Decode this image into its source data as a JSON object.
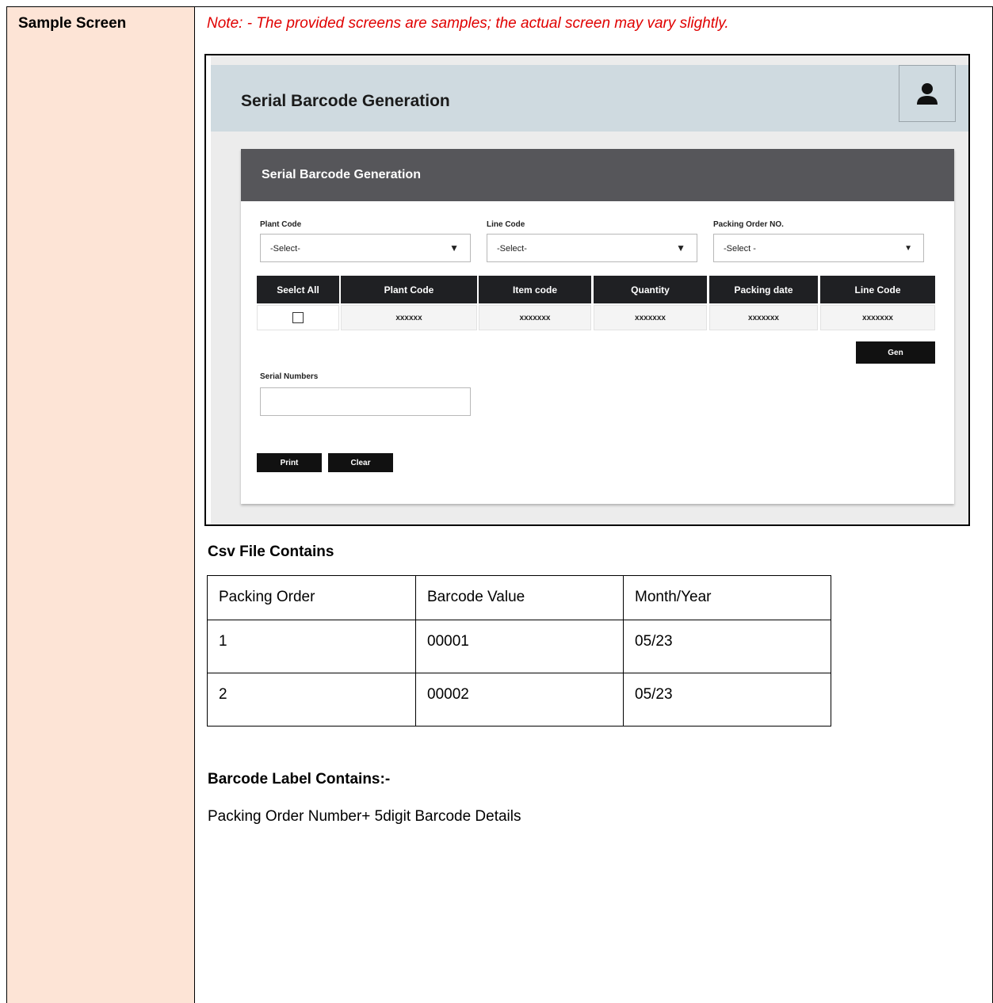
{
  "document": {
    "left_label": "Sample Screen",
    "note": "Note: - The provided screens are samples; the actual screen may vary slightly."
  },
  "mockup": {
    "header_title": "Serial Barcode Generation",
    "user_icon": "user-icon",
    "panel_title": "Serial Barcode Generation",
    "fields": [
      {
        "label": "Plant Code",
        "value": "-Select-"
      },
      {
        "label": "Line Code",
        "value": "-Select-"
      },
      {
        "label": "Packing Order NO.",
        "value": "-Select -"
      }
    ],
    "dropdown_arrow": "▼",
    "table": {
      "headers": [
        "Seelct All",
        "Plant Code",
        "Item code",
        "Quantity",
        "Packing date",
        "Line  Code"
      ],
      "row": [
        "",
        "xxxxxx",
        "xxxxxxx",
        "xxxxxxx",
        "xxxxxxx",
        "xxxxxxx"
      ]
    },
    "gen_label": "Gen",
    "serial_label": "Serial Numbers",
    "print_label": "Print",
    "clear_label": "Clear"
  },
  "csv": {
    "heading": "Csv File Contains",
    "headers": [
      "Packing Order",
      "Barcode Value",
      "Month/Year"
    ],
    "rows": [
      [
        "1",
        "00001",
        "05/23"
      ],
      [
        "2",
        "00002",
        "05/23"
      ]
    ]
  },
  "barcode_label": {
    "heading": "Barcode Label Contains:-",
    "text": "Packing Order Number+ 5digit Barcode Details"
  }
}
